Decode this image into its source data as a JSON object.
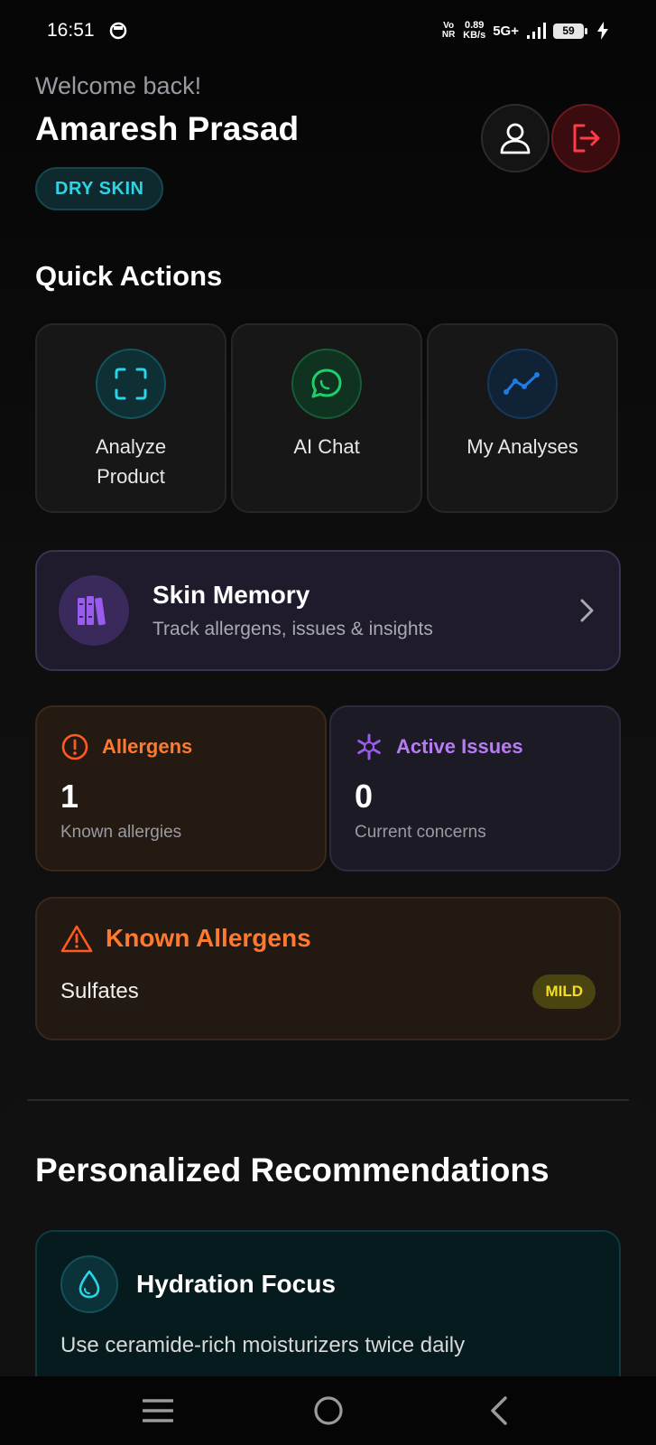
{
  "status_bar": {
    "time": "16:51",
    "vonr": "Vo NR",
    "speed_value": "0.89",
    "speed_unit": "KB/s",
    "network": "5G+",
    "battery": "59"
  },
  "header": {
    "welcome": "Welcome back!",
    "user_name": "Amaresh Prasad",
    "skin_type": "DRY SKIN"
  },
  "quick_actions": {
    "title": "Quick Actions",
    "items": [
      {
        "label": "Analyze Product",
        "icon": "scan-icon"
      },
      {
        "label": "AI Chat",
        "icon": "chat-icon"
      },
      {
        "label": "My Analyses",
        "icon": "trend-icon"
      }
    ]
  },
  "skin_memory": {
    "title": "Skin Memory",
    "subtitle": "Track allergens, issues & insights"
  },
  "stats": {
    "allergens": {
      "label": "Allergens",
      "value": "1",
      "sub": "Known allergies"
    },
    "issues": {
      "label": "Active Issues",
      "value": "0",
      "sub": "Current concerns"
    }
  },
  "known_allergens": {
    "title": "Known Allergens",
    "items": [
      {
        "name": "Sulfates",
        "severity": "MILD"
      }
    ]
  },
  "recommendations": {
    "title": "Personalized Recommendations",
    "items": [
      {
        "title": "Hydration Focus",
        "desc": "Use ceramide-rich moisturizers twice daily"
      }
    ]
  },
  "colors": {
    "accent_teal": "#2bd4e6",
    "accent_green": "#1fcf6a",
    "accent_blue": "#1e7be0",
    "accent_purple": "#9a5cf0",
    "accent_orange": "#ff7a2e",
    "danger_red": "#ff3b45",
    "mild_yellow": "#f4dc2a"
  }
}
